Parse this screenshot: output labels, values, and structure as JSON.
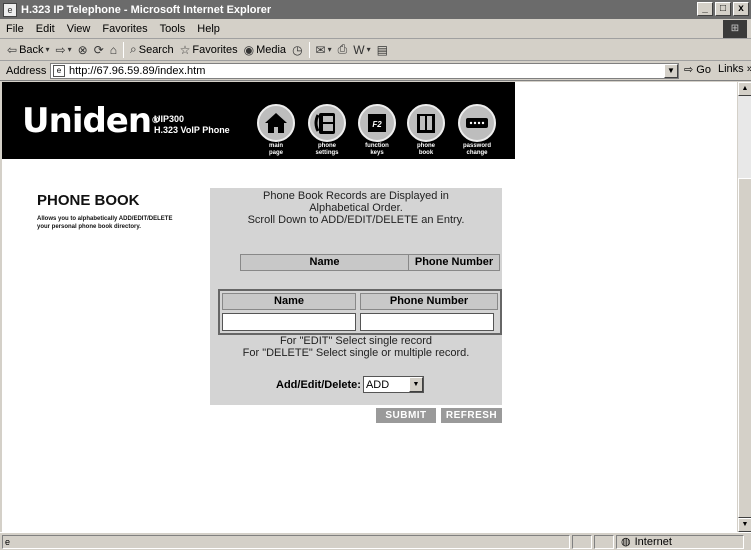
{
  "window": {
    "title": "H.323 IP Telephone - Microsoft Internet Explorer",
    "min": "_",
    "max": "□",
    "close": "x"
  },
  "menu": [
    "File",
    "Edit",
    "View",
    "Favorites",
    "Tools",
    "Help"
  ],
  "toolbar": {
    "back": "Back",
    "search": "Search",
    "favorites": "Favorites",
    "media": "Media"
  },
  "address": {
    "label": "Address",
    "url": "http://67.96.59.89/index.htm",
    "go": "Go",
    "links": "Links »"
  },
  "banner": {
    "logo": "Uniden",
    "model_line1": "UIP300",
    "model_line2": "H.323 VoIP Phone",
    "nav": [
      {
        "l1": "main",
        "l2": "page"
      },
      {
        "l1": "phone",
        "l2": "settings"
      },
      {
        "l1": "function",
        "l2": "keys"
      },
      {
        "l1": "phone",
        "l2": "book"
      },
      {
        "l1": "password",
        "l2": "change"
      }
    ],
    "f2": "F2"
  },
  "page": {
    "title": "PHONE BOOK",
    "desc": "Allows you to alphabetically ADD/EDIT/DELETE your personal phone book directory.",
    "info1": "Phone Book Records are Displayed in",
    "info2": "Alphabetical Order.",
    "info3": "Scroll Down to ADD/EDIT/DELETE an Entry.",
    "list_col_name": "Name",
    "list_col_number": "Phone Number",
    "edit_col_name": "Name",
    "edit_col_number": "Phone Number",
    "name_value": "",
    "number_value": "",
    "note1": "For \"EDIT\" Select single record",
    "note2": "For \"DELETE\" Select single or multiple record.",
    "action_label": "Add/Edit/Delete:",
    "action_value": "ADD",
    "submit": "SUBMIT",
    "refresh": "REFRESH"
  },
  "status": {
    "zone": "Internet"
  }
}
